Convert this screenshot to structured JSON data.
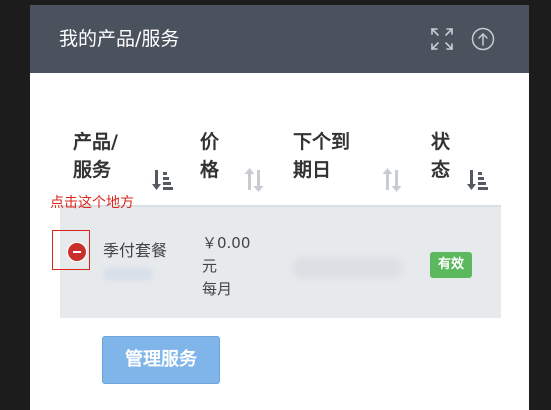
{
  "panel": {
    "title": "我的产品/服务"
  },
  "table": {
    "columns": [
      {
        "line1": "产品/",
        "line2": "服务",
        "sort": "active"
      },
      {
        "line1": "价",
        "line2": "格",
        "sort": "inactive"
      },
      {
        "line1": "下个到",
        "line2": "期日",
        "sort": "inactive"
      },
      {
        "line1": "状",
        "line2": "态",
        "sort": "active"
      }
    ],
    "row": {
      "plan_name": "季付套餐",
      "price_amount": "￥0.00",
      "price_unit": "元",
      "price_cycle": "每月",
      "status": "有效"
    }
  },
  "annotation": {
    "label": "点击这个地方"
  },
  "actions": {
    "manage_label": "管理服务"
  },
  "colors": {
    "header_bg": "#4a525d",
    "row_bg": "#e7eaec",
    "status_green": "#5cb85c",
    "button_blue": "#7fb5e9",
    "annotation_red": "#d9261c"
  }
}
